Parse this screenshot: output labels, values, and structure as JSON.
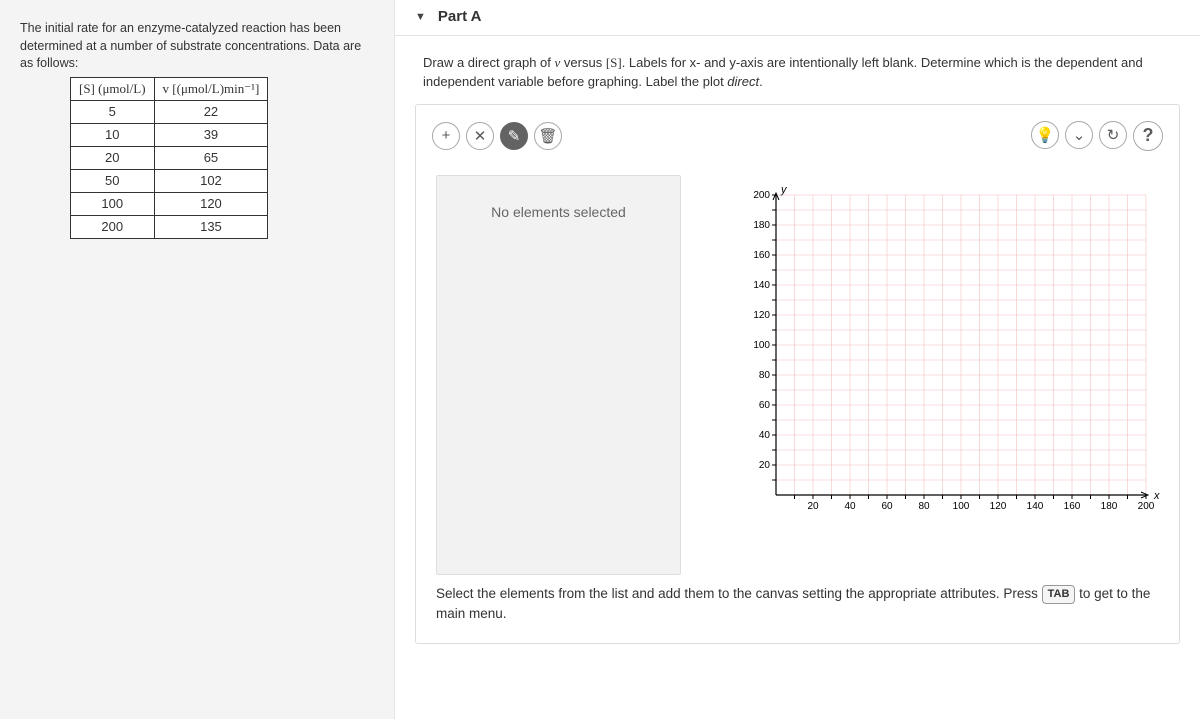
{
  "left": {
    "intro": "The initial rate for an enzyme-catalyzed reaction has been determined at a number of substrate concentrations. Data are as follows:",
    "headers": {
      "s": "[S] (μmol/L)",
      "v": "v [(μmol/L)min⁻¹]"
    },
    "rows": [
      {
        "s": "5",
        "v": "22"
      },
      {
        "s": "10",
        "v": "39"
      },
      {
        "s": "20",
        "v": "65"
      },
      {
        "s": "50",
        "v": "102"
      },
      {
        "s": "100",
        "v": "120"
      },
      {
        "s": "200",
        "v": "135"
      }
    ]
  },
  "right": {
    "part_label": "Part A",
    "instruction_a": "Draw a direct graph of ",
    "instruction_b": " versus ",
    "instruction_c": ". Labels for x- and y-axis are intentionally left blank. Determine which is the dependent and independent variable before graphing. Label the plot ",
    "instruction_d": ".",
    "v_sym": "v",
    "s_sym": "[S]",
    "direct_word": "direct",
    "no_selection": "No elements selected",
    "footer_a": "Select the elements from the list and add them to the canvas setting the appropriate attributes. Press ",
    "tab_key": "TAB",
    "footer_b": " to get to the main menu."
  },
  "graph": {
    "x_label": "x",
    "y_label": "y",
    "ticks": [
      "20",
      "40",
      "60",
      "80",
      "100",
      "120",
      "140",
      "160",
      "180",
      "200"
    ]
  },
  "icons": {
    "add": "+",
    "nopoint": "✕",
    "draw": "✎",
    "trash": "🗑",
    "bulb": "💡",
    "chevron": "⌄",
    "reload": "↻",
    "help": "?"
  }
}
